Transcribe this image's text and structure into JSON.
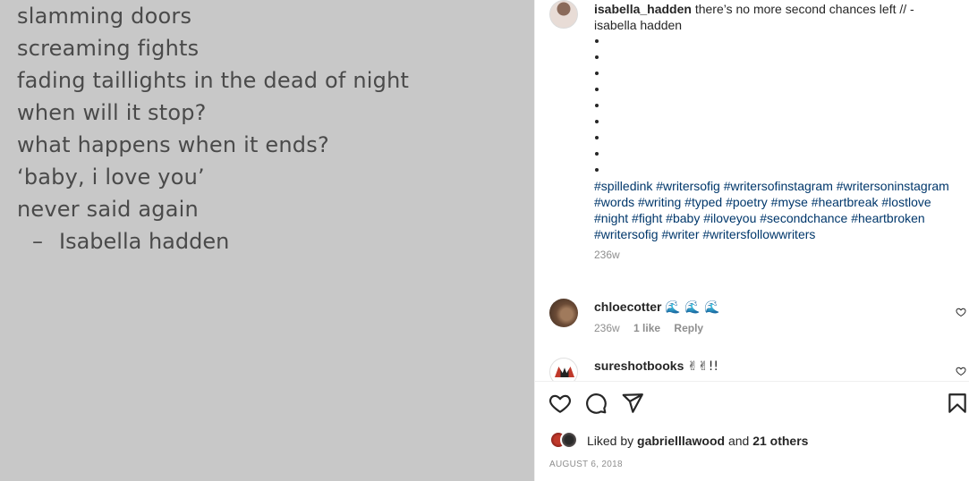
{
  "image": {
    "lines": [
      "slamming doors",
      "screaming fights",
      "fading taillights in the dead of night",
      "when will it stop?",
      "what happens when it ends?",
      "‘baby, i love you’",
      "never said again"
    ],
    "attribution_dash": "–",
    "attribution_name": "Isabella hadden",
    "background": "#c8c8c8"
  },
  "caption": {
    "username": "isabella_hadden",
    "text": " there’s no more second chances left // - isabella hadden",
    "bullet_count": 9,
    "hashtags": "#spilledink #writersofig #writersofinstagram #writersoninstagram #words #writing #typed #poetry #myse #heartbreak #lostlove #night #fight #baby #iloveyou #secondchance #heartbroken #writersofig #writer #writersfollowwriters",
    "age": "236w"
  },
  "comments": [
    {
      "username": "chloecotter",
      "text": "🌊 🌊 🌊",
      "age": "236w",
      "likes": "1 like",
      "reply": "Reply"
    },
    {
      "username": "sureshotbooks",
      "text": "✌✌!!"
    }
  ],
  "actions": {
    "like_icon": "heart-icon",
    "comment_icon": "comment-icon",
    "share_icon": "share-icon",
    "save_icon": "bookmark-icon"
  },
  "likes": {
    "prefix": "Liked by ",
    "user": "gabrielllawood",
    "middle": " and ",
    "others": "21 others"
  },
  "post_date": "AUGUST 6, 2018",
  "colors": {
    "hashtag": "#00376b",
    "text": "#262626",
    "muted": "#8e8e8e"
  }
}
